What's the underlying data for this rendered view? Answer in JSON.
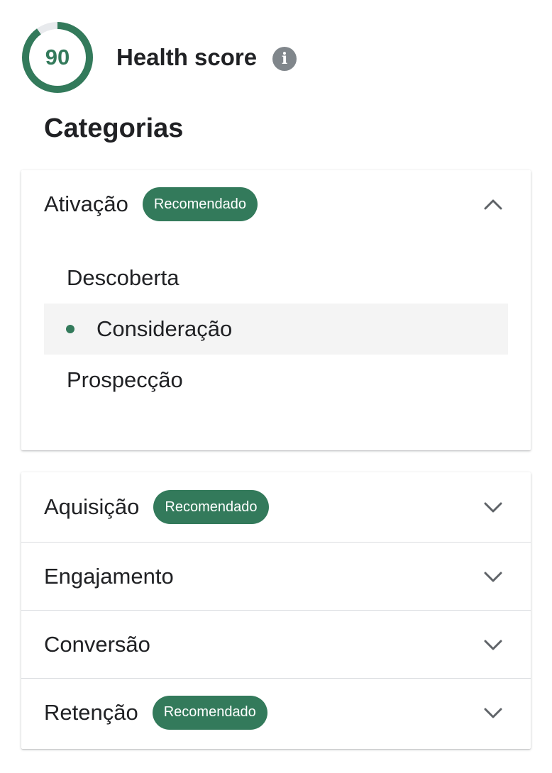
{
  "health": {
    "score": "90",
    "score_fraction": 0.9,
    "title": "Health score",
    "info_icon": "info-icon",
    "ring_color": "#337a5b",
    "ring_track_color": "#e8eaed"
  },
  "section_title": "Categorias",
  "badge_color": "#337a5b",
  "expanded_category": {
    "label": "Ativação",
    "badge": "Recomendado",
    "chevron": "chevron-up-icon",
    "subcategories": [
      {
        "label": "Descoberta",
        "selected": false
      },
      {
        "label": "Consideração",
        "selected": true
      },
      {
        "label": "Prospecção",
        "selected": false
      }
    ]
  },
  "categories": [
    {
      "label": "Aquisição",
      "badge": "Recomendado",
      "chevron": "chevron-down-icon"
    },
    {
      "label": "Engajamento",
      "badge": "",
      "chevron": "chevron-down-icon"
    },
    {
      "label": "Conversão",
      "badge": "",
      "chevron": "chevron-down-icon"
    },
    {
      "label": "Retenção",
      "badge": "Recomendado",
      "chevron": "chevron-down-icon"
    }
  ]
}
